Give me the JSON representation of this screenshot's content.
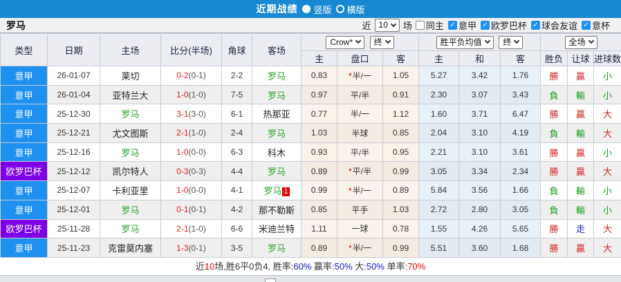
{
  "colors": {
    "accent_blue": "#1789d2",
    "league": {
      "serie_a": "#1e90f0",
      "europa_cup": "#7d00e6"
    },
    "result": {
      "勝": "#d42222",
      "負": "#1a9a1a",
      "贏": "#d42222",
      "輸": "#1a9a1a",
      "走": "#2222cc",
      "大": "#d42222",
      "小": "#1a9a1a"
    },
    "roma_green": "#2ca02c",
    "score_red": "#e02020",
    "checkbox_blue": "#1e90f5"
  },
  "topbar": {
    "title": "近期战绩",
    "layout_options": [
      {
        "label": "竖版",
        "selected": true
      },
      {
        "label": "横版",
        "selected": false
      }
    ]
  },
  "filterbar": {
    "team_title": "罗马",
    "recent_label": "近",
    "recent_count": "10",
    "games_label": "场",
    "checkboxes": [
      {
        "label": "同主",
        "checked": false
      },
      {
        "label": "意甲",
        "checked": true
      },
      {
        "label": "欧罗巴杯",
        "checked": true
      },
      {
        "label": "球会友谊",
        "checked": true
      },
      {
        "label": "意杯",
        "checked": true
      }
    ]
  },
  "table": {
    "static_headers": [
      "类型",
      "日期",
      "主场",
      "比分(半场)",
      "角球",
      "客场"
    ],
    "odds_groups": [
      {
        "selects": [
          "Crow*",
          "终"
        ],
        "subcols": [
          "主",
          "盘口",
          "客"
        ]
      },
      {
        "selects": [
          "胜平负均值",
          "终"
        ],
        "subcols": [
          "主",
          "和",
          "客"
        ]
      },
      {
        "selects": [
          "全场"
        ],
        "subcols": [
          "胜负",
          "让球",
          "进球数"
        ]
      }
    ],
    "rows": [
      {
        "league": "意甲",
        "league_type": "serie_a",
        "date": "26-01-07",
        "home": "莱切",
        "home_is_roma": false,
        "score": "0-2",
        "half": "(0-1)",
        "corners": "2-2",
        "away": "罗马",
        "away_is_roma": true,
        "away_card": "",
        "ah_home": "0.83",
        "ah_star": true,
        "ah_line": "半/一",
        "ah_away": "1.05",
        "odds_home": "5.27",
        "odds_draw": "3.42",
        "odds_away": "1.76",
        "result": "勝",
        "handicap_result": "贏",
        "goals_result": "小"
      },
      {
        "league": "意甲",
        "league_type": "serie_a",
        "date": "26-01-04",
        "home": "亚特兰大",
        "home_is_roma": false,
        "score": "1-0",
        "half": "(1-0)",
        "corners": "7-5",
        "away": "罗马",
        "away_is_roma": true,
        "away_card": "",
        "ah_home": "0.97",
        "ah_star": false,
        "ah_line": "平/半",
        "ah_away": "0.91",
        "odds_home": "2.30",
        "odds_draw": "3.07",
        "odds_away": "3.43",
        "result": "負",
        "handicap_result": "輸",
        "goals_result": "小"
      },
      {
        "league": "意甲",
        "league_type": "serie_a",
        "date": "25-12-30",
        "home": "罗马",
        "home_is_roma": true,
        "score": "3-1",
        "half": "(3-0)",
        "corners": "6-1",
        "away": "热那亚",
        "away_is_roma": false,
        "away_card": "",
        "ah_home": "0.77",
        "ah_star": false,
        "ah_line": "半/一",
        "ah_away": "1.12",
        "odds_home": "1.60",
        "odds_draw": "3.71",
        "odds_away": "6.47",
        "result": "勝",
        "handicap_result": "贏",
        "goals_result": "大"
      },
      {
        "league": "意甲",
        "league_type": "serie_a",
        "date": "25-12-21",
        "home": "尤文图斯",
        "home_is_roma": false,
        "score": "2-1",
        "half": "(1-0)",
        "corners": "2-4",
        "away": "罗马",
        "away_is_roma": true,
        "away_card": "",
        "ah_home": "1.03",
        "ah_star": false,
        "ah_line": "半球",
        "ah_away": "0.85",
        "odds_home": "2.04",
        "odds_draw": "3.10",
        "odds_away": "4.19",
        "result": "負",
        "handicap_result": "輸",
        "goals_result": "大"
      },
      {
        "league": "意甲",
        "league_type": "serie_a",
        "date": "25-12-16",
        "home": "罗马",
        "home_is_roma": true,
        "score": "1-0",
        "half": "(0-0)",
        "corners": "6-3",
        "away": "科木",
        "away_is_roma": false,
        "away_card": "",
        "ah_home": "0.93",
        "ah_star": false,
        "ah_line": "平/半",
        "ah_away": "0.95",
        "odds_home": "2.21",
        "odds_draw": "3.10",
        "odds_away": "3.61",
        "result": "勝",
        "handicap_result": "贏",
        "goals_result": "小"
      },
      {
        "league": "欧罗巴杯",
        "league_type": "europa_cup",
        "date": "25-12-12",
        "home": "凯尔特人",
        "home_is_roma": false,
        "score": "0-3",
        "half": "(0-3)",
        "corners": "4-4",
        "away": "罗马",
        "away_is_roma": true,
        "away_card": "",
        "ah_home": "0.89",
        "ah_star": true,
        "ah_line": "平/半",
        "ah_away": "0.99",
        "odds_home": "3.05",
        "odds_draw": "3.34",
        "odds_away": "2.34",
        "result": "勝",
        "handicap_result": "贏",
        "goals_result": "大"
      },
      {
        "league": "意甲",
        "league_type": "serie_a",
        "date": "25-12-07",
        "home": "卡利亚里",
        "home_is_roma": false,
        "score": "1-0",
        "half": "(0-0)",
        "corners": "4-1",
        "away": "罗马",
        "away_is_roma": true,
        "away_card": "1",
        "ah_home": "0.99",
        "ah_star": true,
        "ah_line": "半/一",
        "ah_away": "0.89",
        "odds_home": "5.84",
        "odds_draw": "3.56",
        "odds_away": "1.66",
        "result": "負",
        "handicap_result": "輸",
        "goals_result": "小"
      },
      {
        "league": "意甲",
        "league_type": "serie_a",
        "date": "25-12-01",
        "home": "罗马",
        "home_is_roma": true,
        "score": "0-1",
        "half": "(0-1)",
        "corners": "4-2",
        "away": "那不勒斯",
        "away_is_roma": false,
        "away_card": "",
        "ah_home": "0.85",
        "ah_star": false,
        "ah_line": "平手",
        "ah_away": "1.03",
        "odds_home": "2.72",
        "odds_draw": "2.80",
        "odds_away": "3.05",
        "result": "負",
        "handicap_result": "輸",
        "goals_result": "小"
      },
      {
        "league": "欧罗巴杯",
        "league_type": "europa_cup",
        "date": "25-11-28",
        "home": "罗马",
        "home_is_roma": true,
        "score": "2-1",
        "half": "(1-0)",
        "corners": "6-6",
        "away": "米迪兰特",
        "away_is_roma": false,
        "away_card": "",
        "ah_home": "1.11",
        "ah_star": false,
        "ah_line": "一球",
        "ah_away": "0.78",
        "odds_home": "1.55",
        "odds_draw": "4.26",
        "odds_away": "5.65",
        "result": "勝",
        "handicap_result": "走",
        "goals_result": "大"
      },
      {
        "league": "意甲",
        "league_type": "serie_a",
        "date": "25-11-23",
        "home": "克雷莫内塞",
        "home_is_roma": false,
        "score": "1-3",
        "half": "(0-1)",
        "corners": "3-5",
        "away": "罗马",
        "away_is_roma": true,
        "away_card": "",
        "ah_home": "0.89",
        "ah_star": true,
        "ah_line": "半/一",
        "ah_away": "0.99",
        "odds_home": "5.51",
        "odds_draw": "3.60",
        "odds_away": "1.68",
        "result": "勝",
        "handicap_result": "贏",
        "goals_result": "大"
      }
    ]
  },
  "footer": {
    "segments": [
      {
        "text": "近",
        "color": "#333333"
      },
      {
        "text": "10",
        "color": "#e00000"
      },
      {
        "text": "场,胜6平0负4, 胜率:",
        "color": "#333333"
      },
      {
        "text": "60%",
        "color": "#1515d0"
      },
      {
        "text": " 赢率:",
        "color": "#333333"
      },
      {
        "text": "50%",
        "color": "#1515d0"
      },
      {
        "text": " 大:",
        "color": "#333333"
      },
      {
        "text": "50%",
        "color": "#1515d0"
      },
      {
        "text": " 单率:",
        "color": "#333333"
      },
      {
        "text": "70%",
        "color": "#e00000"
      }
    ]
  }
}
